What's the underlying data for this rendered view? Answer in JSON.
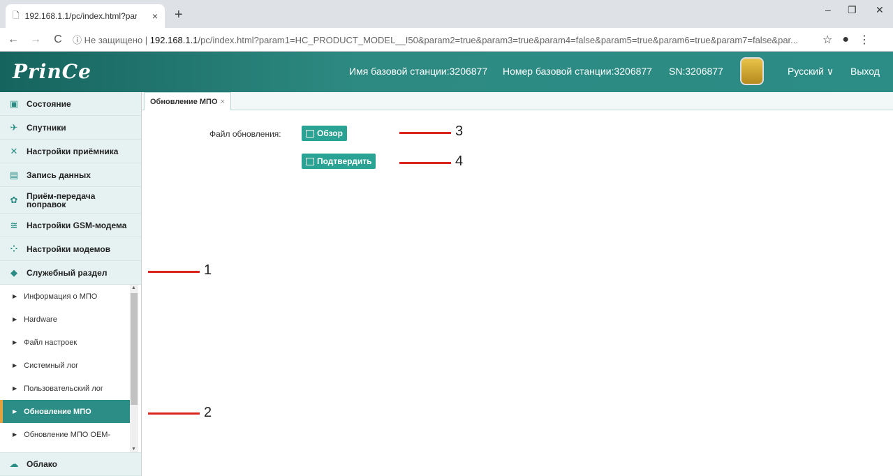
{
  "browser": {
    "tab_title": "192.168.1.1/pc/index.html?param",
    "tab_close": "×",
    "new_tab": "+",
    "win_min": "–",
    "win_max": "❐",
    "win_close": "✕",
    "security_label": "ⓘ Не защищено |",
    "url_host": "192.168.1.1",
    "url_rest": "/pc/index.html?param1=HC_PRODUCT_MODEL__I50&param2=true&param3=true&param4=false&param5=true&param6=true&param7=false&par..."
  },
  "header": {
    "logo": "PrinCe",
    "station_name": "Имя базовой станции:3206877",
    "station_number": "Номер базовой станции:3206877",
    "sn": "SN:3206877",
    "language": "Русский",
    "logout": "Выход"
  },
  "sidebar": {
    "items": [
      {
        "label": "Состояние",
        "icon": "monitor-icon"
      },
      {
        "label": "Спутники",
        "icon": "satellite-icon"
      },
      {
        "label": "Настройки приёмника",
        "icon": "tools-icon"
      },
      {
        "label": "Запись данных",
        "icon": "list-icon"
      },
      {
        "label": "Приём-передача поправок",
        "icon": "gear-icon"
      },
      {
        "label": "Настройки GSM-модема",
        "icon": "wifi-icon"
      },
      {
        "label": "Настройки модемов",
        "icon": "grid-icon"
      },
      {
        "label": "Служебный раздел",
        "icon": "layers-icon"
      }
    ],
    "subitems": [
      "Информация о МПО",
      "Hardware",
      "Файл настроек",
      "Системный лог",
      "Пользовательский лог",
      "Обновление МПО",
      "Обновление МПО OEM-"
    ],
    "bottom_item": {
      "label": "Облако",
      "icon": "cloud-icon"
    }
  },
  "content": {
    "tab_label": "Обновление МПО",
    "tab_close": "×",
    "file_label": "Файл обновления:",
    "browse_button": "Обзор",
    "confirm_button": "Подтвердить"
  },
  "annotations": {
    "n1": "1",
    "n2": "2",
    "n3": "3",
    "n4": "4",
    "color": "#d9251c"
  }
}
